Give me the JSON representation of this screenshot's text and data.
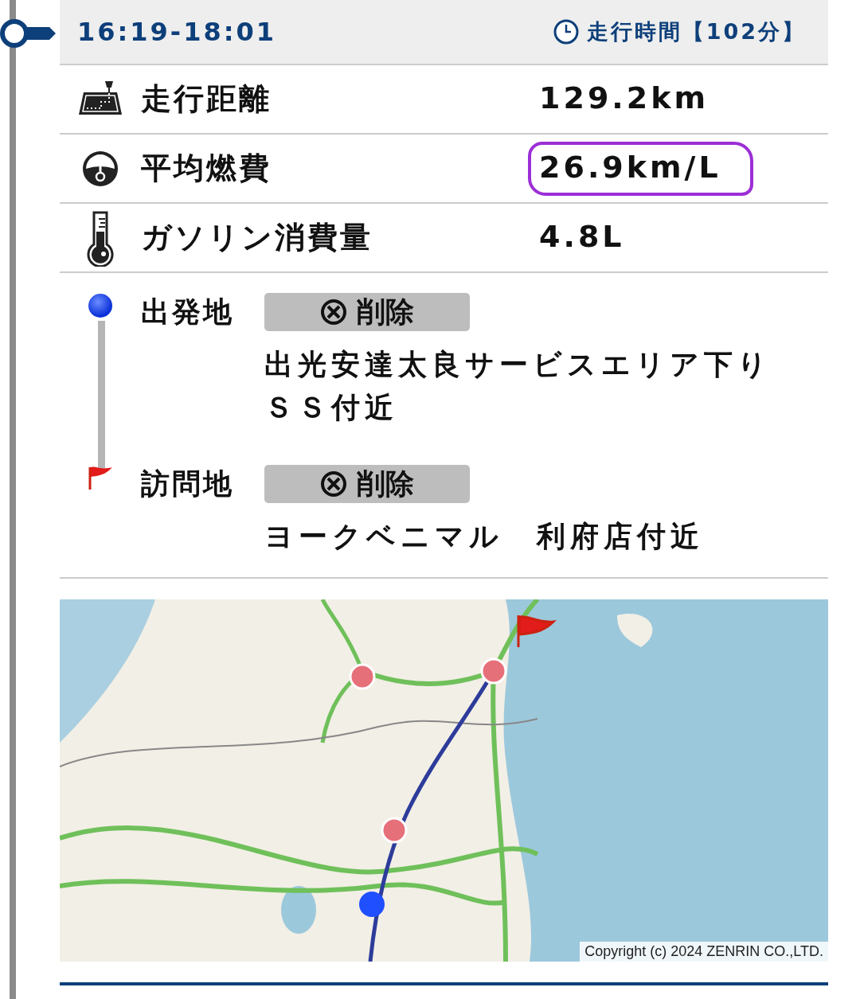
{
  "header": {
    "time_range": "16:19-18:01",
    "duration": "走行時間【102分】"
  },
  "stats": [
    {
      "kind": "distance",
      "label": "走行距離",
      "value": "129.2km",
      "circled": false
    },
    {
      "kind": "fuel_economy",
      "label": "平均燃費",
      "value": "26.9km/L",
      "circled": true
    },
    {
      "kind": "fuel_used",
      "label": "ガソリン消費量",
      "value": "4.8L",
      "circled": false
    }
  ],
  "places": [
    {
      "kind": "start",
      "label": "出発地",
      "button": "削除",
      "name": "出光安達太良サービスエリア下りＳＳ付近"
    },
    {
      "kind": "visit",
      "label": "訪問地",
      "button": "削除",
      "name": "ヨークベニマル　利府店付近"
    }
  ],
  "map": {
    "kind": "picture",
    "copyright": "Copyright (c) 2024 ZENRIN CO.,LTD."
  }
}
